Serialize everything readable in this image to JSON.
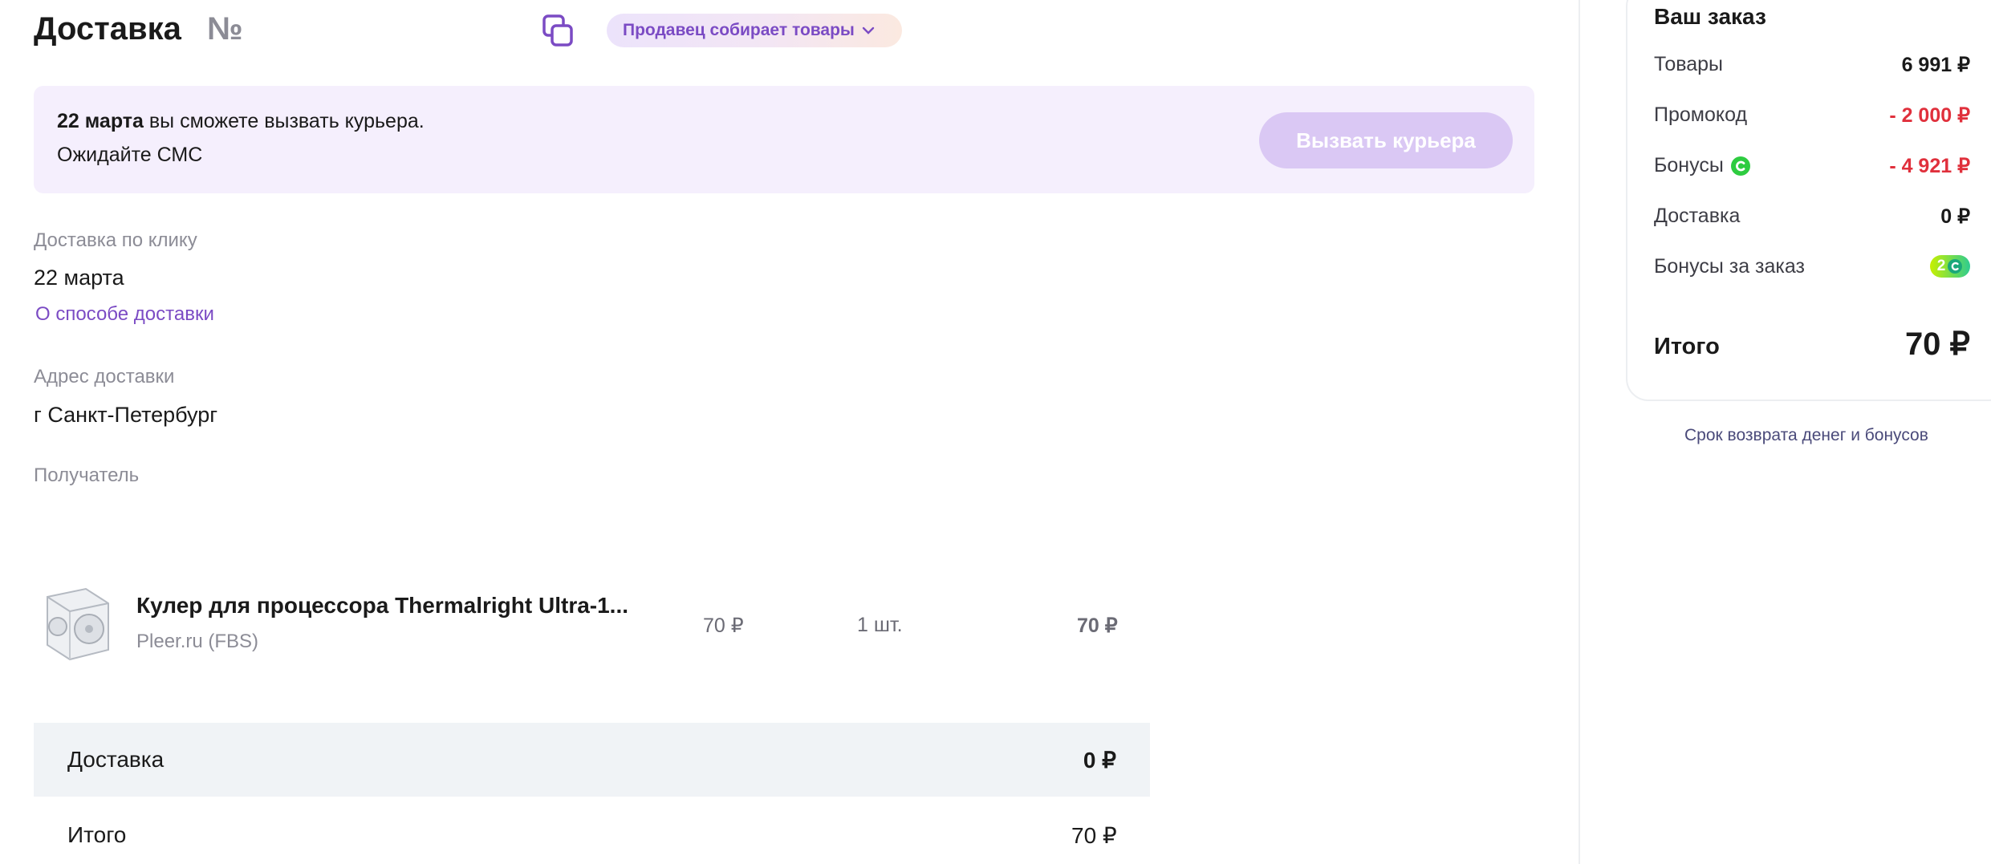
{
  "header": {
    "title": "Доставка",
    "order_number_symbol": "№",
    "status": "Продавец собирает товары"
  },
  "notice": {
    "date_bold": "22 марта",
    "line1_rest": " вы сможете вызвать курьера.",
    "line2": "Ожидайте СМС",
    "button_label": "Вызвать курьера"
  },
  "delivery": {
    "method_label": "Доставка по клику",
    "date": "22 марта",
    "about_link": "О способе доставки",
    "address_label": "Адрес доставки",
    "address": "г Санкт-Петербург",
    "recipient_label": "Получатель"
  },
  "product": {
    "name": "Кулер для процессора Thermalright Ultra-1...",
    "seller": "Pleer.ru (FBS)",
    "price": "70 ₽",
    "quantity": "1 шт.",
    "total": "70 ₽"
  },
  "order_footer": {
    "delivery_label": "Доставка",
    "delivery_value": "0 ₽",
    "total_label": "Итого",
    "total_value": "70 ₽"
  },
  "summary": {
    "title": "Ваш заказ",
    "rows": [
      {
        "label": "Товары",
        "value": "6 991 ₽"
      },
      {
        "label": "Промокод",
        "value": "- 2 000 ₽"
      },
      {
        "label": "Бонусы",
        "value": "- 4 921 ₽"
      },
      {
        "label": "Доставка",
        "value": "0 ₽"
      },
      {
        "label": "Бонусы за заказ",
        "value": "2"
      }
    ],
    "total_label": "Итого",
    "total_value": "70 ₽",
    "refund_link": "Срок возврата денег и бонусов"
  },
  "colors": {
    "accent": "#7b4bc4",
    "negative": "#e0303c",
    "bonus_green": "#2ecc40"
  },
  "icons": [
    "copy-icon",
    "chevron-down-icon",
    "bonus-coin-icon",
    "cooler-product-image"
  ]
}
